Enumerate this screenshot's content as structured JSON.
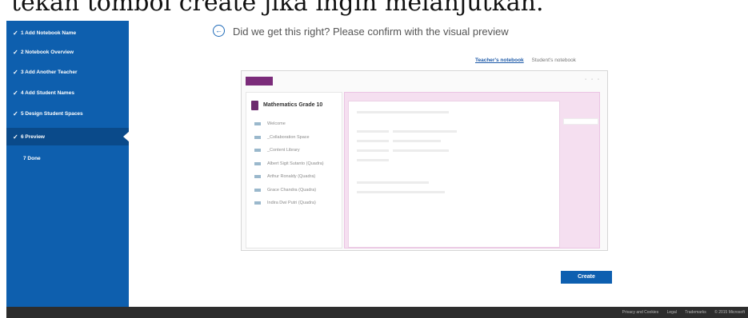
{
  "caption": "tekan tombol create jika ingin melanjutkan.",
  "steps": [
    {
      "label": "1 Add Notebook Name",
      "done": true
    },
    {
      "label": "2 Notebook Overview",
      "done": true
    },
    {
      "label": "3 Add Another Teacher",
      "done": true
    },
    {
      "label": "4 Add Student Names",
      "done": true
    },
    {
      "label": "5 Design Student Spaces",
      "done": true
    },
    {
      "label": "6 Preview",
      "done": true,
      "active": true
    },
    {
      "label": "7 Done",
      "done": false
    }
  ],
  "heading": "Did we get this right? Please confirm with the visual preview",
  "tabs": {
    "teacher": "Teacher's notebook",
    "student": "Student's notebook"
  },
  "preview": {
    "window_controls": "▫ ▫ ▫",
    "notebook_title": "Mathematics Grade 10",
    "sections": [
      "Welcome",
      "_Collaboration Space",
      "_Content Library",
      "Albert Sigit Sutanto (Quadra)",
      "Arthur Ronaldy (Quadra)",
      "Grace Chandra (Quadra)",
      "Indira Dwi Putri (Quadra)"
    ],
    "tab_colors": [
      "#a8d47a",
      "#8fd6cf",
      "#f2e27a"
    ],
    "accent": "#7b2c7a"
  },
  "create_label": "Create",
  "footer": [
    "Privacy and Cookies",
    "Legal",
    "Trademarks",
    "© 2015 Microsoft"
  ],
  "colors": {
    "sidebar": "#0e5fae",
    "primary_button": "#0d5fb0",
    "footer": "#2d2d2d"
  }
}
